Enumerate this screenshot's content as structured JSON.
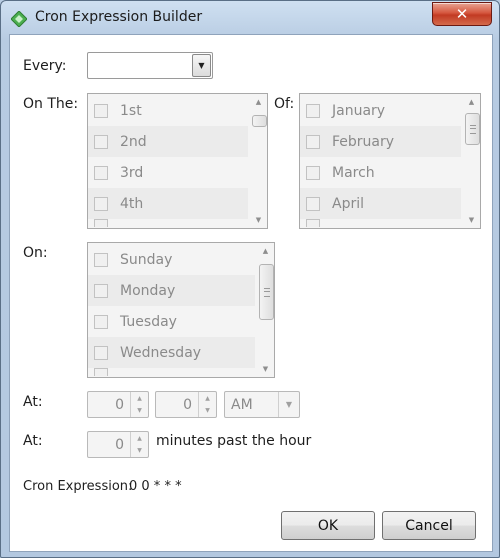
{
  "window": {
    "title": "Cron Expression Builder",
    "close_glyph": "✕",
    "app_icon": "green-diamond-icon"
  },
  "form": {
    "every_label": "Every:",
    "every_value": "",
    "on_the_label": "On The:",
    "of_label": "Of:",
    "on_label": "On:",
    "at_label_1": "At:",
    "at_label_2": "At:",
    "minutes_suffix": "minutes past the hour",
    "cron_label": "Cron Expression:",
    "cron_value": "0 0 * * *"
  },
  "on_the_list": [
    {
      "label": "1st",
      "checked": false
    },
    {
      "label": "2nd",
      "checked": false
    },
    {
      "label": "3rd",
      "checked": false
    },
    {
      "label": "4th",
      "checked": false
    }
  ],
  "months_list": [
    {
      "label": "January",
      "checked": false
    },
    {
      "label": "February",
      "checked": false
    },
    {
      "label": "March",
      "checked": false
    },
    {
      "label": "April",
      "checked": false
    }
  ],
  "days_list": [
    {
      "label": "Sunday",
      "checked": false
    },
    {
      "label": "Monday",
      "checked": false
    },
    {
      "label": "Tuesday",
      "checked": false
    },
    {
      "label": "Wednesday",
      "checked": false
    }
  ],
  "at_time": {
    "hour": "0",
    "minute": "0",
    "ampm": "AM"
  },
  "at_minutes": {
    "value": "0"
  },
  "buttons": {
    "ok": "OK",
    "cancel": "Cancel"
  },
  "colors": {
    "title_bar": "#b9cde3",
    "close_button": "#c23a23",
    "list_disabled_text": "#8a8a8a"
  }
}
